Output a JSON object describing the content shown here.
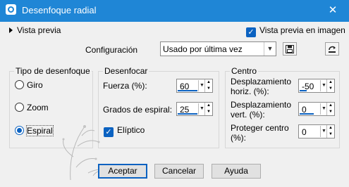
{
  "window": {
    "title": "Desenfoque radial",
    "close_symbol": "✕"
  },
  "preview": {
    "toggle_label": "Vista previa",
    "checkbox_label": "Vista previa en imagen",
    "checked": true
  },
  "config": {
    "label": "Configuración",
    "value": "Usado por última vez"
  },
  "blur_type": {
    "title": "Tipo de desenfoque",
    "options": [
      {
        "label": "Giro",
        "selected": false
      },
      {
        "label": "Zoom",
        "selected": false
      },
      {
        "label": "Espiral",
        "selected": true
      }
    ]
  },
  "blur": {
    "title": "Desenfocar",
    "strength": {
      "label": "Fuerza (%):",
      "value": "60"
    },
    "spiral_degrees": {
      "label": "Grados de espiral:",
      "value": "25"
    },
    "elliptic": {
      "label": "Elíptico",
      "checked": true
    }
  },
  "center": {
    "title": "Centro",
    "h_offset": {
      "label_line1": "Desplazamiento",
      "label_line2": "horiz. (%):",
      "value": "-50"
    },
    "v_offset": {
      "label_line1": "Desplazamiento",
      "label_line2": "vert. (%):",
      "value": "0"
    },
    "protect": {
      "label_line1": "Proteger centro",
      "label_line2": "(%):",
      "value": "0"
    }
  },
  "buttons": {
    "accept": "Aceptar",
    "cancel": "Cancelar",
    "help": "Ayuda"
  },
  "colors": {
    "titlebar": "#1f86d6",
    "accent": "#0b62c1"
  },
  "icons": [
    "app-icon",
    "save-icon",
    "reset-icon",
    "close-icon",
    "watermark-signature"
  ]
}
